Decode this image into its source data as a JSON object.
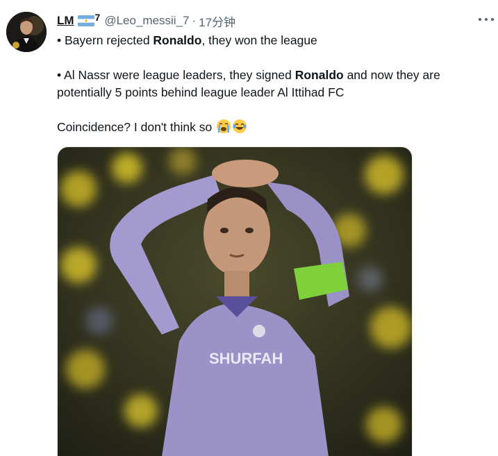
{
  "author": {
    "display_name": "LM",
    "badge": "7",
    "handle": "@Leo_messii_7",
    "separator": "·",
    "timestamp": "17分钟",
    "flag": "argentina-flag-emoji"
  },
  "tweet": {
    "line1_prefix": "• Bayern rejected ",
    "line1_bold": "Ronaldo",
    "line1_suffix": ", they won the league",
    "line2_prefix": "• Al Nassr were league leaders, they signed ",
    "line2_bold": "Ronaldo",
    "line2_suffix": " and now they are potentially 5 points behind league leader Al Ittihad FC",
    "line3": "Coincidence? I don't think so ",
    "emojis": [
      "loudly-crying-face-emoji",
      "tears-of-joy-emoji"
    ]
  },
  "media": {
    "jersey_text": "SHURFAH",
    "colors": {
      "jersey": "#9b93c8",
      "armband": "#7fd13b",
      "background": "#3a3a20"
    }
  },
  "colors": {
    "text": "#0f1419",
    "muted": "#536471"
  }
}
